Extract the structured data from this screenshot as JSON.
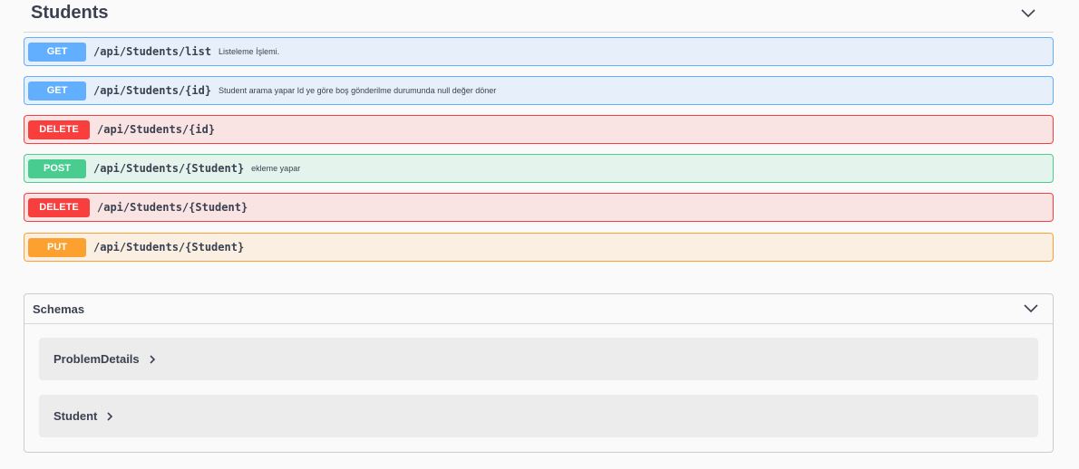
{
  "tag": {
    "title": "Students",
    "chevron_icon": "chevron-down-icon"
  },
  "operations": [
    {
      "method": "GET",
      "path": "/api/Students/list",
      "summary": "Listeleme İşlemi.",
      "color": "#61affe"
    },
    {
      "method": "GET",
      "path": "/api/Students/{id}",
      "summary": "Student arama yapar Id ye göre boş gönderilme durumunda null değer döner",
      "color": "#61affe"
    },
    {
      "method": "DELETE",
      "path": "/api/Students/{id}",
      "summary": "",
      "color": "#f93e3e"
    },
    {
      "method": "POST",
      "path": "/api/Students/{Student}",
      "summary": "ekleme yapar",
      "color": "#49cc90"
    },
    {
      "method": "DELETE",
      "path": "/api/Students/{Student}",
      "summary": "",
      "color": "#f93e3e"
    },
    {
      "method": "PUT",
      "path": "/api/Students/{Student}",
      "summary": "",
      "color": "#fca130"
    }
  ],
  "schemas": {
    "title": "Schemas",
    "models": [
      {
        "name": "ProblemDetails"
      },
      {
        "name": "Student"
      }
    ]
  }
}
